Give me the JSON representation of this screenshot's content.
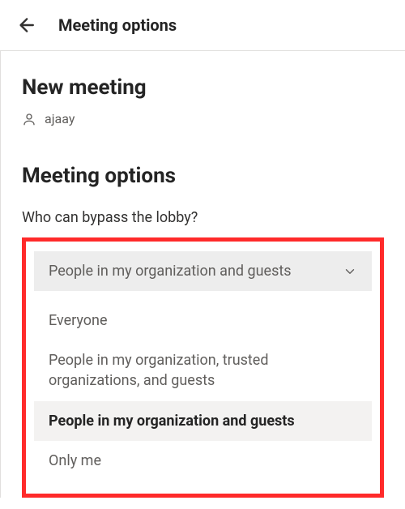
{
  "header": {
    "title": "Meeting options"
  },
  "meeting": {
    "new_label": "New meeting",
    "organizer": "ajaay"
  },
  "options": {
    "heading": "Meeting options",
    "lobby": {
      "label": "Who can bypass the lobby?",
      "selected": "People in my organization and guests",
      "items": [
        "Everyone",
        "People in my organization, trusted organizations, and guests",
        "People in my organization and guests",
        "Only me"
      ]
    }
  }
}
